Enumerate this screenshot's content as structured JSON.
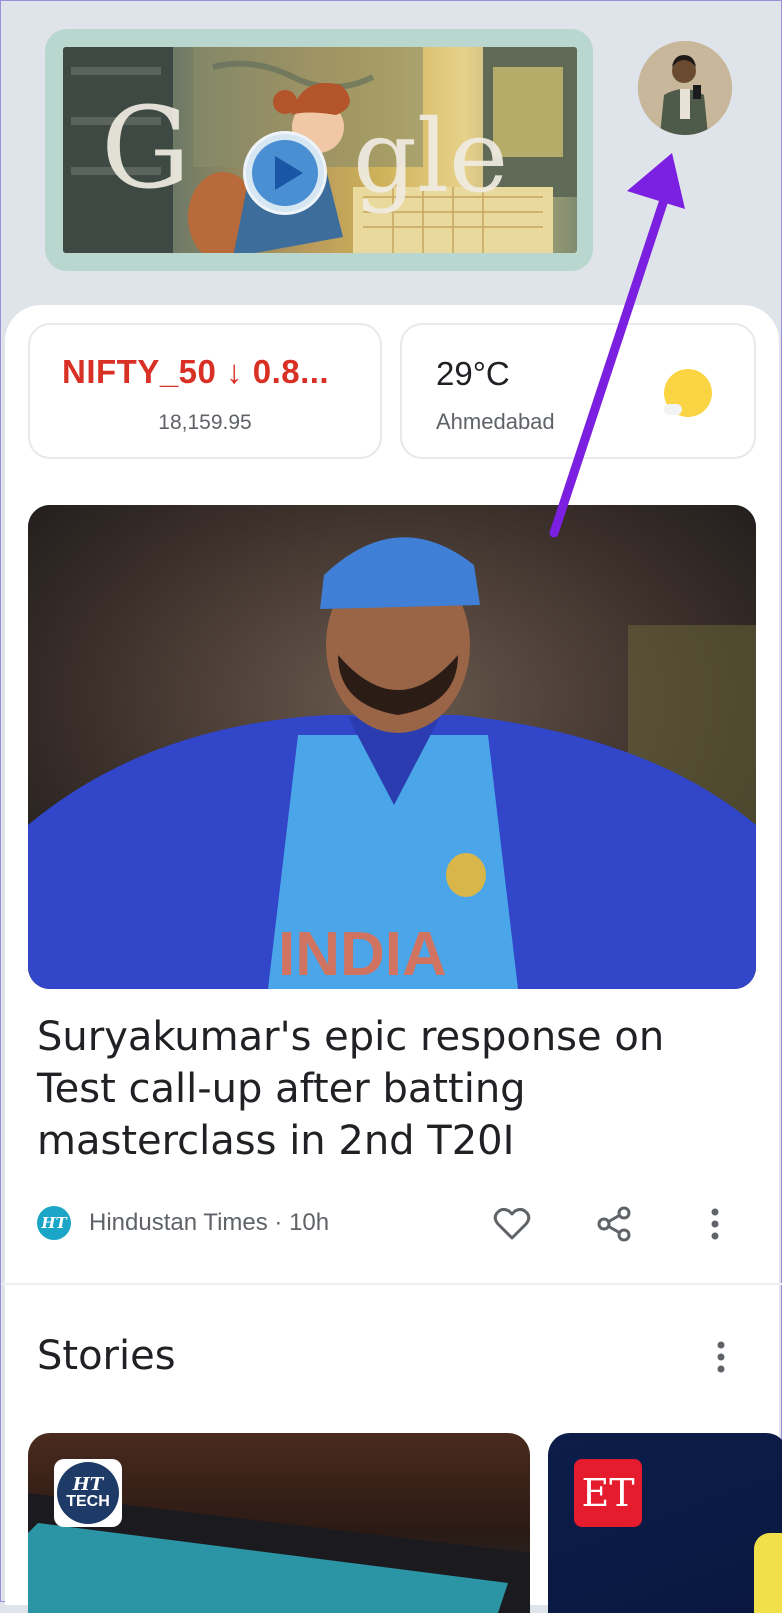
{
  "doodle": {
    "logo_letters": [
      "G",
      "gle"
    ],
    "play_icon": "play-icon"
  },
  "avatar": {
    "icon": "profile-avatar"
  },
  "stock_chip": {
    "label": "NIFTY_50 ↓ 0.8...",
    "value": "18,159.95",
    "color": "#d93025"
  },
  "weather_chip": {
    "temperature": "29°C",
    "city": "Ahmedabad",
    "icon": "partly-sunny-icon"
  },
  "article": {
    "headline": "Suryakumar's epic response on Test call-up after batting masterclass in 2nd T20I",
    "source_logo": "HT",
    "source": "Hindustan Times · 10h",
    "actions": [
      "heart-icon",
      "share-icon",
      "more-vert-icon"
    ]
  },
  "stories": {
    "title": "Stories",
    "cards": [
      {
        "badge_line1": "HT",
        "badge_line2": "TECH"
      },
      {
        "badge_line1": "ET"
      }
    ]
  },
  "annotation": {
    "color": "#7b1fe0"
  }
}
